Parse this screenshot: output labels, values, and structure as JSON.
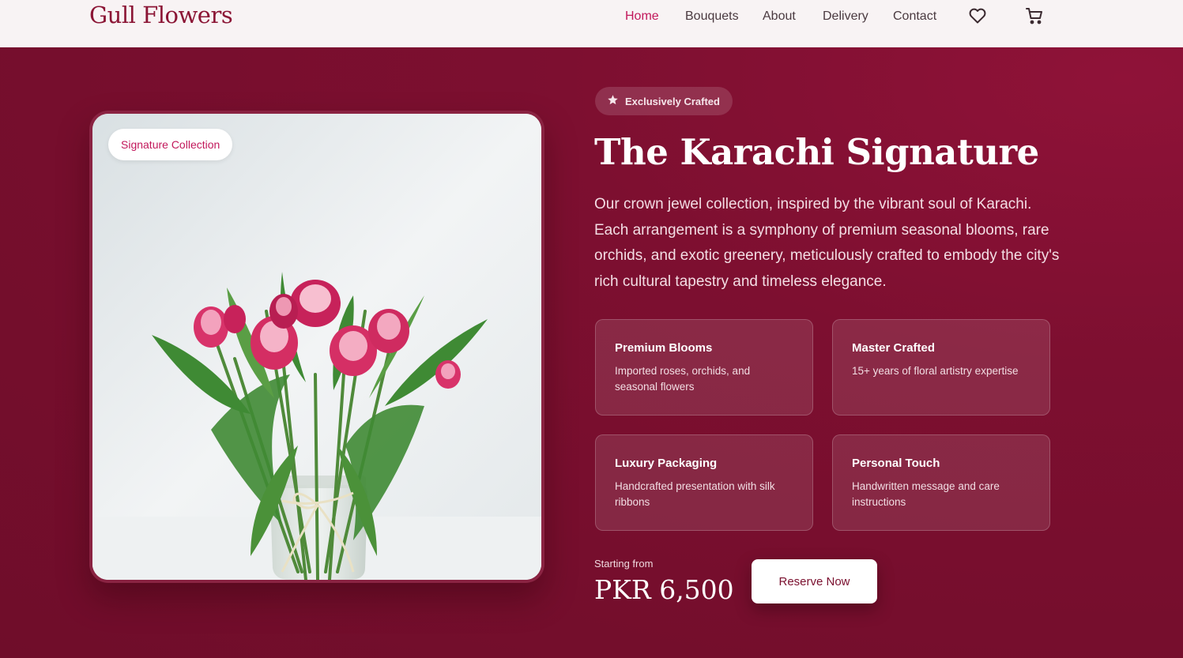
{
  "header": {
    "brand": "Gull Flowers",
    "nav": [
      "Home",
      "Bouquets",
      "About",
      "Delivery",
      "Contact"
    ],
    "active_nav": "Home",
    "icons": [
      "heart-icon",
      "cart-icon"
    ]
  },
  "hero": {
    "image_badge": "Signature Collection",
    "pill": "Exclusively Crafted",
    "pill_icon": "star-icon",
    "title": "The Karachi Signature",
    "description": "Our crown jewel collection, inspired by the vibrant soul of Karachi. Each arrangement is a symphony of premium seasonal blooms, rare orchids, and exotic greenery, meticulously crafted to embody the city's rich cultural tapestry and timeless elegance.",
    "features": [
      {
        "title": "Premium Blooms",
        "desc": "Imported roses, orchids, and seasonal flowers"
      },
      {
        "title": "Master Crafted",
        "desc": "15+ years of floral artistry expertise"
      },
      {
        "title": "Luxury Packaging",
        "desc": "Handcrafted presentation with silk ribbons"
      },
      {
        "title": "Personal Touch",
        "desc": "Handwritten message and care instructions"
      }
    ],
    "price_label": "Starting from",
    "price": "PKR 6,500",
    "cta": "Reserve Now"
  },
  "colors": {
    "accent": "#c2185b",
    "hero_bg": "#7a0f2e",
    "brand": "#8b1535"
  }
}
